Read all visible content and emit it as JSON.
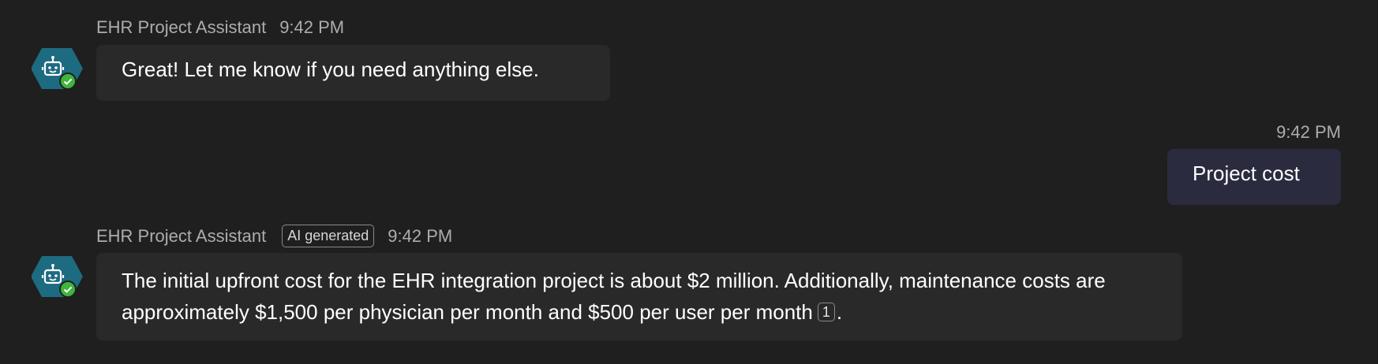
{
  "colors": {
    "background": "#1f1f1f",
    "bot_bubble": "#292929",
    "user_bubble": "#2b2b40",
    "avatar_teal": "#1d6b80",
    "status_green": "#3fb53a",
    "meta_text": "#adadad"
  },
  "messages": [
    {
      "sender": "EHR Project Assistant",
      "time": "9:42 PM",
      "text": "Great! Let me know if you need anything else.",
      "avatar_icon": "bot-icon",
      "status_icon": "checkmark-icon"
    },
    {
      "time": "9:42 PM",
      "text": "Project cost"
    },
    {
      "sender": "EHR Project Assistant",
      "badge": "AI generated",
      "time": "9:42 PM",
      "text": "The initial upfront cost for the EHR integration project is about $2 million. Additionally, maintenance costs are approximately $1,500 per physician per month and $500 per user per month",
      "citation": "1",
      "trailing": ".",
      "avatar_icon": "bot-icon",
      "status_icon": "checkmark-icon"
    }
  ]
}
